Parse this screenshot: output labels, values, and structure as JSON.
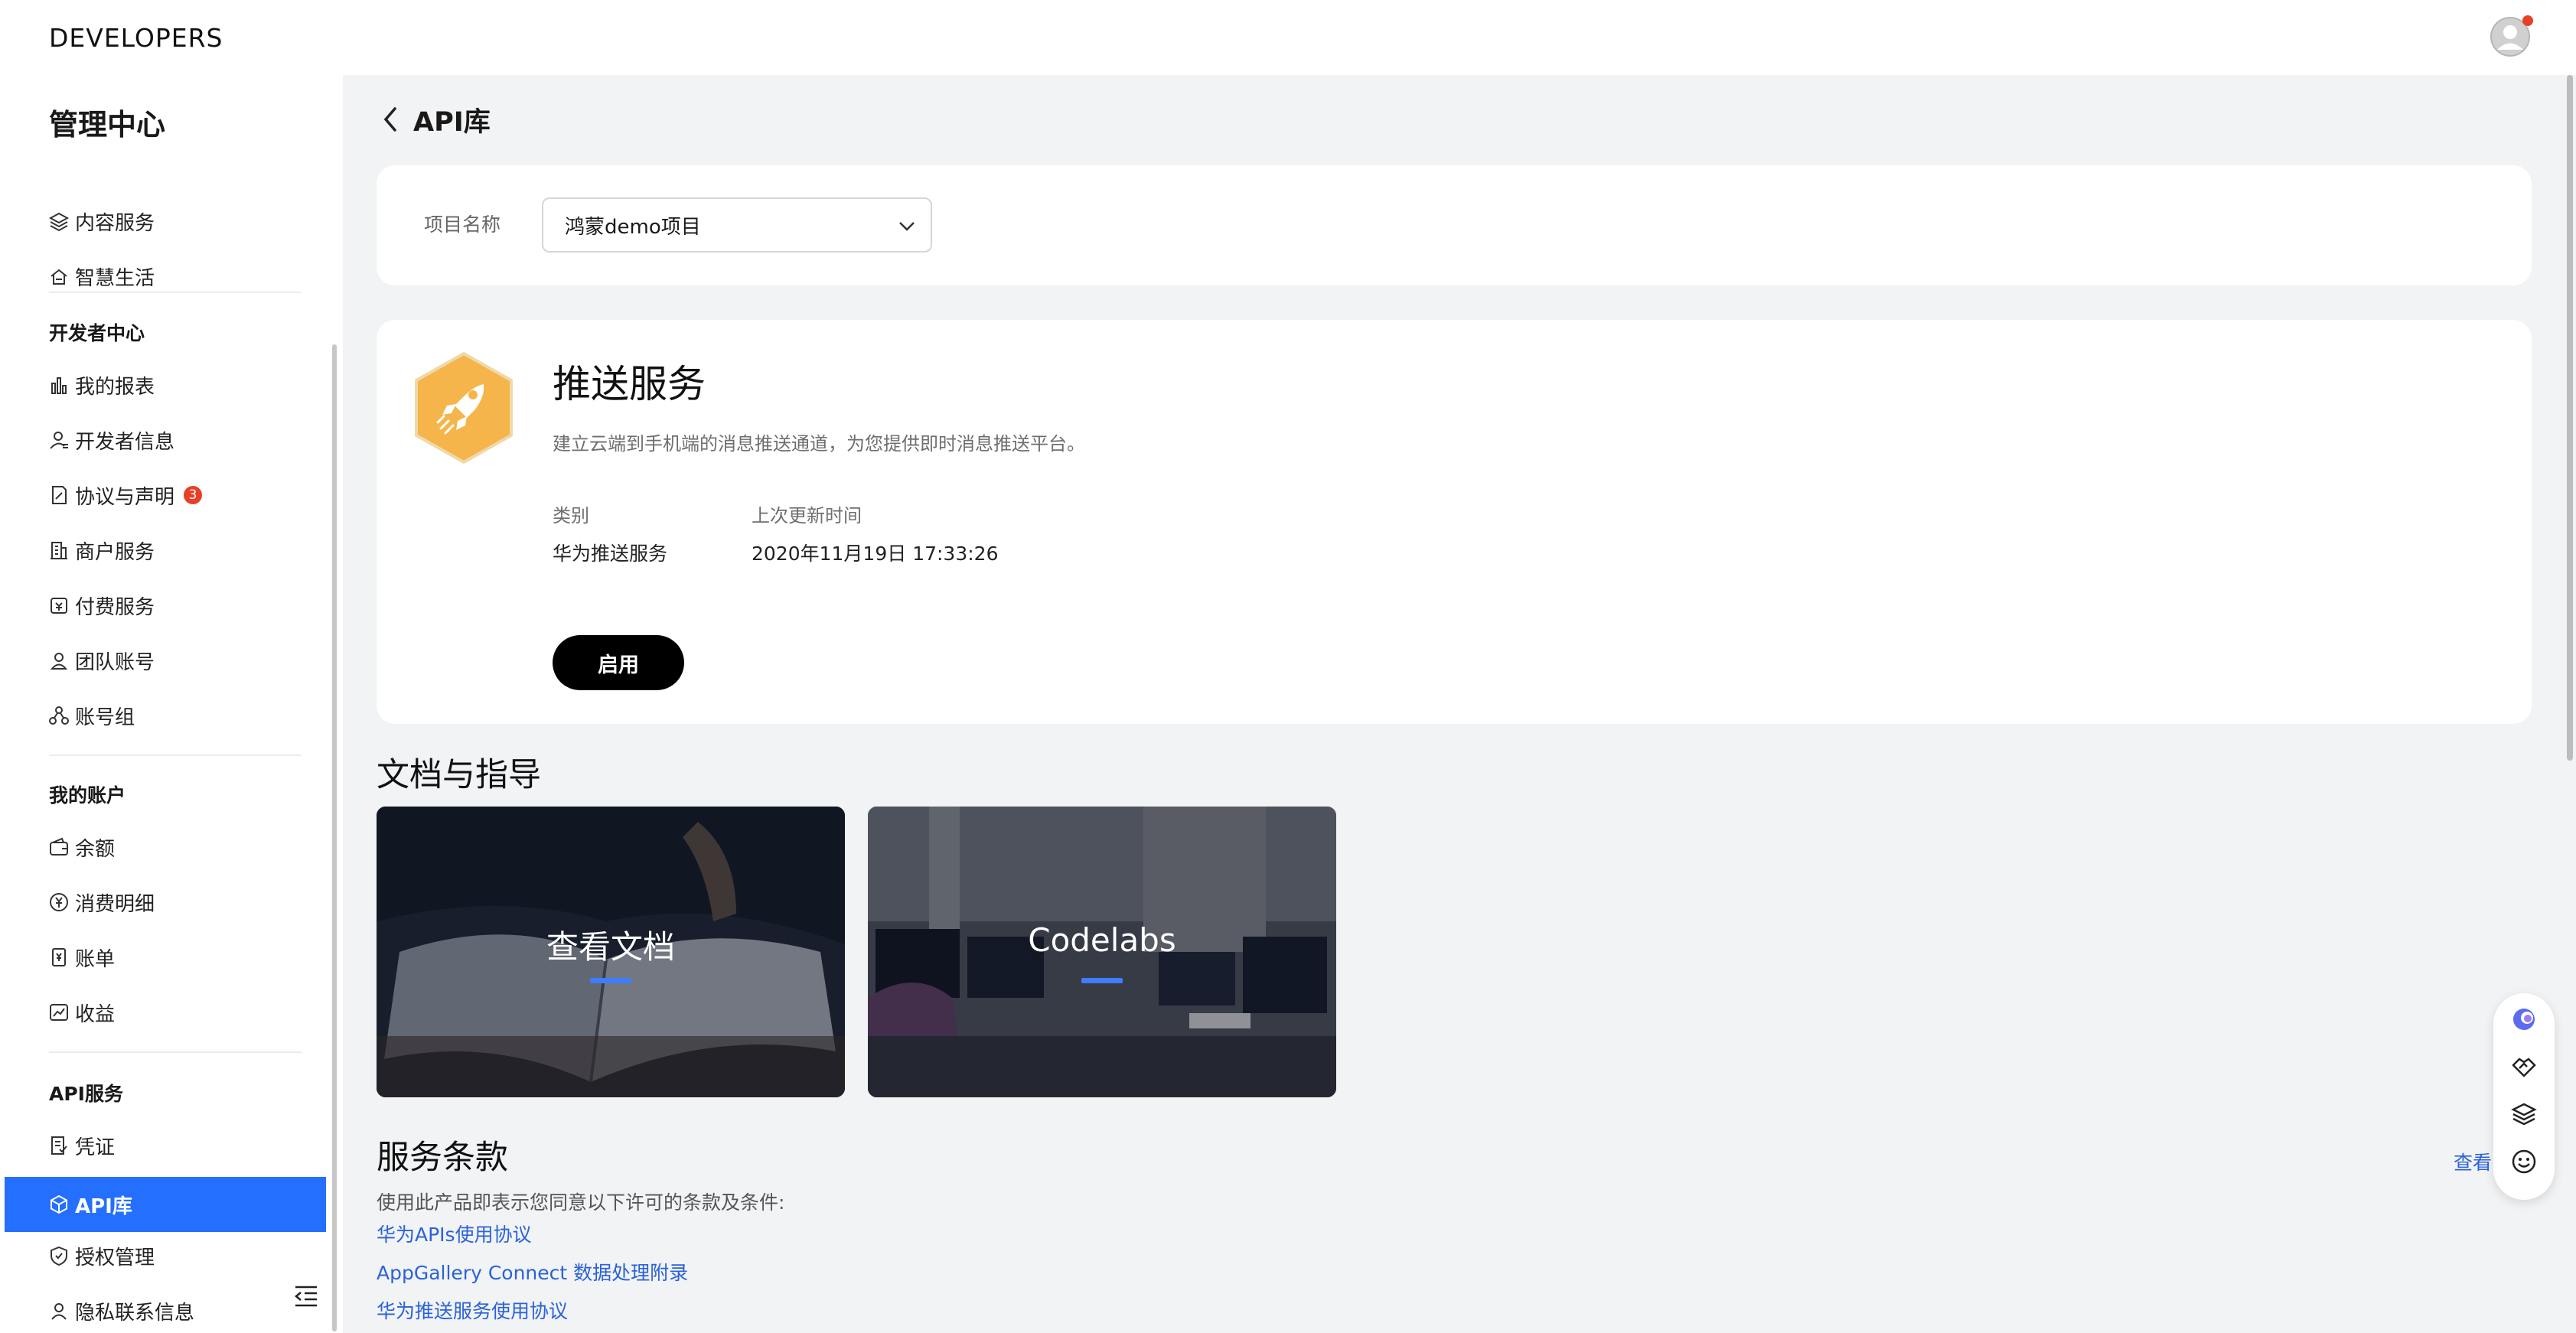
{
  "topbar": {
    "brand": "DEVELOPERS"
  },
  "sidebar": {
    "title": "管理中心",
    "top_items": [
      {
        "label": "内容服务",
        "icon": "layers-icon"
      },
      {
        "label": "智慧生活",
        "icon": "home-cloud-icon"
      }
    ],
    "dev_center": {
      "heading": "开发者中心",
      "items": [
        {
          "label": "我的报表",
          "icon": "chart-icon"
        },
        {
          "label": "开发者信息",
          "icon": "user-icon"
        },
        {
          "label": "协议与声明",
          "icon": "document-icon",
          "badge": "3"
        },
        {
          "label": "商户服务",
          "icon": "building-icon"
        },
        {
          "label": "付费服务",
          "icon": "pay-icon"
        },
        {
          "label": "团队账号",
          "icon": "team-icon"
        },
        {
          "label": "账号组",
          "icon": "group-icon"
        }
      ]
    },
    "account": {
      "heading": "我的账户",
      "items": [
        {
          "label": "余额",
          "icon": "wallet-icon"
        },
        {
          "label": "消费明细",
          "icon": "yen-icon"
        },
        {
          "label": "账单",
          "icon": "bill-icon"
        },
        {
          "label": "收益",
          "icon": "income-icon"
        }
      ]
    },
    "api": {
      "heading": "API服务",
      "items": [
        {
          "label": "凭证",
          "icon": "credential-icon"
        },
        {
          "label": "API库",
          "icon": "cube-icon",
          "active": true
        },
        {
          "label": "授权管理",
          "icon": "shield-icon"
        },
        {
          "label": "隐私联系信息",
          "icon": "privacy-icon"
        }
      ]
    }
  },
  "main": {
    "title": "API库",
    "project": {
      "label": "项目名称",
      "value": "鸿蒙demo项目"
    },
    "service": {
      "name": "推送服务",
      "description": "建立云端到手机端的消息推送通道，为您提供即时消息推送平台。",
      "category_label": "类别",
      "category_value": "华为推送服务",
      "updated_label": "上次更新时间",
      "updated_value": "2020年11月19日 17:33:26",
      "enable_button": "启用",
      "icon_color": "#f5b54a"
    },
    "docs": {
      "title": "文档与指导",
      "tiles": [
        {
          "label": "查看文档"
        },
        {
          "label": "Codelabs"
        }
      ]
    },
    "terms": {
      "title": "服务条款",
      "description": "使用此产品即表示您同意以下许可的条款及条件:",
      "links": [
        "华为APIs使用协议",
        "AppGallery Connect 数据处理附录",
        "华为推送服务使用协议"
      ],
      "view_link": "查看"
    }
  },
  "colors": {
    "accent": "#256fff",
    "link": "#2a62d9",
    "badge": "#e84026"
  }
}
